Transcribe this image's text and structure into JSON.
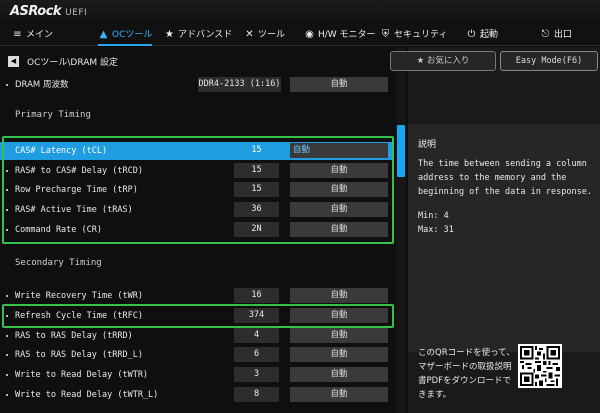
{
  "header": {
    "logo": "ASRock",
    "logo_sub": "UEFI"
  },
  "nav": [
    {
      "label": "メイン",
      "icon": "menu-icon",
      "glyph": "≡"
    },
    {
      "label": "OCツール",
      "icon": "flame-icon",
      "glyph": "▲"
    },
    {
      "label": "アドバンスド",
      "icon": "star-icon",
      "glyph": "★"
    },
    {
      "label": "ツール",
      "icon": "tools-icon",
      "glyph": "✕"
    },
    {
      "label": "H/W モニター",
      "icon": "monitor-icon",
      "glyph": "◉"
    },
    {
      "label": "セキュリティ",
      "icon": "shield-icon",
      "glyph": "⛨"
    },
    {
      "label": "起動",
      "icon": "power-icon",
      "glyph": "⏻"
    },
    {
      "label": "出口",
      "icon": "exit-icon",
      "glyph": "⎋"
    }
  ],
  "breadcrumb": {
    "back_glyph": "◀",
    "path": "OCツール\\DRAM 設定"
  },
  "dram": {
    "label": "DRAM 周波数",
    "value": "DDR4-2133 (1:16)",
    "mode": "自動"
  },
  "sections": {
    "primary": "Primary Timing",
    "secondary": "Secondary Timing"
  },
  "primary_rows": [
    {
      "label": "CAS# Latency (tCL)",
      "value": "15",
      "mode": "自動"
    },
    {
      "label": "RAS# to CAS# Delay (tRCD)",
      "value": "15",
      "mode": "自動"
    },
    {
      "label": "Row Precharge Time (tRP)",
      "value": "15",
      "mode": "自動"
    },
    {
      "label": "RAS# Active Time (tRAS)",
      "value": "36",
      "mode": "自動"
    },
    {
      "label": "Command Rate (CR)",
      "value": "2N",
      "mode": "自動"
    }
  ],
  "secondary_rows": [
    {
      "label": "Write Recovery Time (tWR)",
      "value": "16",
      "mode": "自動"
    },
    {
      "label": "Refresh Cycle Time (tRFC)",
      "value": "374",
      "mode": "自動"
    },
    {
      "label": "RAS to RAS Delay (tRRD)",
      "value": "4",
      "mode": "自動"
    },
    {
      "label": "RAS to RAS Delay (tRRD_L)",
      "value": "6",
      "mode": "自動"
    },
    {
      "label": "Write to Read Delay (tWTR)",
      "value": "3",
      "mode": "自動"
    },
    {
      "label": "Write to Read Delay (tWTR_L)",
      "value": "8",
      "mode": "自動"
    }
  ],
  "right": {
    "favorite_btn": "お気に入り",
    "easy_mode_btn": "Easy Mode(F6)",
    "desc_title": "説明",
    "desc_text": "The time between sending a column address to the memory and the beginning of the data in response.",
    "min": "Min: 4",
    "max": "Max: 31",
    "qr_text": "このQRコードを使って、マザーボードの取扱説明書PDFをダウンロードできます。"
  },
  "colors": {
    "accent": "#1f9de0",
    "highlight_box": "#36c24a",
    "active_nav": "#39b4ff"
  }
}
